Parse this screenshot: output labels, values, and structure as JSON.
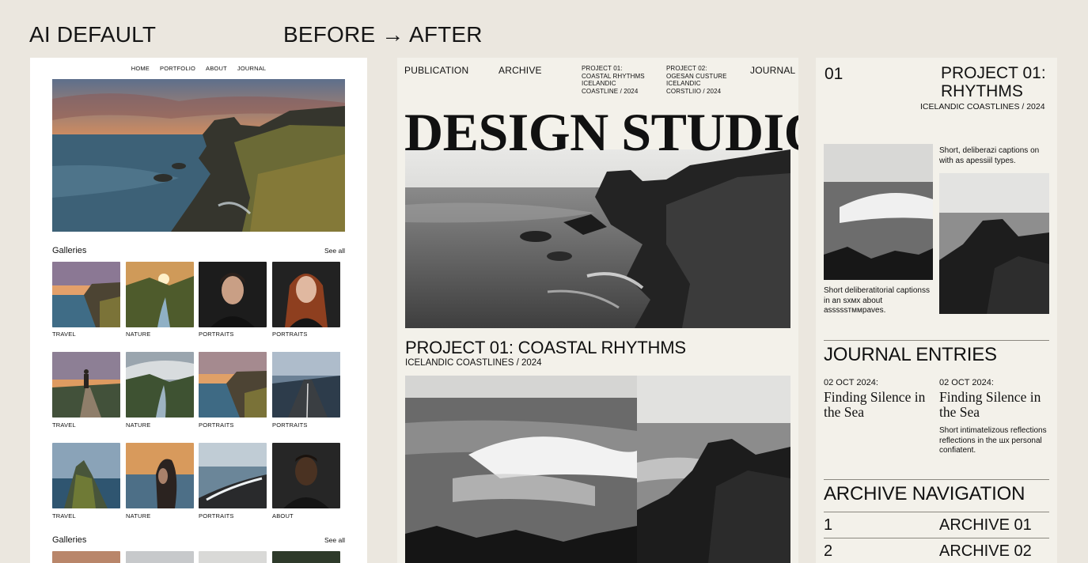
{
  "headings": {
    "left": "AI DEFAULT",
    "right": "BEFORE → AFTER"
  },
  "left_panel": {
    "nav": [
      "HOME",
      "PORTFOLIO",
      "ABOUT",
      "JOURNAL"
    ],
    "section1_title": "Galleries",
    "section1_see_all": "See all",
    "section2_title": "Galleries",
    "section2_see_all": "See all",
    "thumbnails": [
      {
        "label": "TRAVEL"
      },
      {
        "label": "NATURE"
      },
      {
        "label": "PORTRAITS"
      },
      {
        "label": "PORTRAITS"
      },
      {
        "label": "TRAVEL"
      },
      {
        "label": "NATURE"
      },
      {
        "label": "PORTRAITS"
      },
      {
        "label": "PORTRAITS"
      },
      {
        "label": "TRAVEL"
      },
      {
        "label": "NATURE"
      },
      {
        "label": "PORTRAITS"
      },
      {
        "label": "ABOUT"
      }
    ]
  },
  "middle_panel": {
    "nav": {
      "publication": "PUBLICATION",
      "archive": "ARCHIVE",
      "project1": [
        "PROJECT 01:",
        "COASTAL RHYTHMS",
        "ICELANDIC",
        "COASTLINE / 2024"
      ],
      "project2": [
        "PROJECT 02:",
        "OGESAN CUSTURE",
        "ICELANDIC",
        "CORSTLIIO / 2024"
      ],
      "journal": "JOURNAL"
    },
    "headline": "DESIGN STUDIO",
    "project_title": "PROJECT 01: COASTAL RHYTHMS",
    "project_subtitle": "ICELANDIC COASTLINES / 2024"
  },
  "right_panel": {
    "number": "01",
    "title_line1": "PROJECT 01:",
    "title_line2": "RHYTHMS",
    "subtitle": "ICELANDIC COASTLINES / 2024",
    "caption_top": "Short, deliberazi captions on with as apessiil types.",
    "caption_bottom": "Short deliberatitorial captionss in an ѕхмх about asѕѕѕѕтммраves.",
    "journal_heading": "JOURNAL ENTRIES",
    "journal_entries": [
      {
        "date": "02 OCT 2024:",
        "title": "Finding Silence in the Sea",
        "body": ""
      },
      {
        "date": "02 OCT 2024:",
        "title": "Finding Silence in the Sea",
        "body": "Short intimatelizous reflections reflections in the шх personal confiatent."
      }
    ],
    "archive_heading": "ARCHIVE NAVIGATION",
    "archive_rows": [
      {
        "num": "1",
        "label": "ARCHIVE 01"
      },
      {
        "num": "2",
        "label": "ARCHIVE 02"
      }
    ]
  }
}
